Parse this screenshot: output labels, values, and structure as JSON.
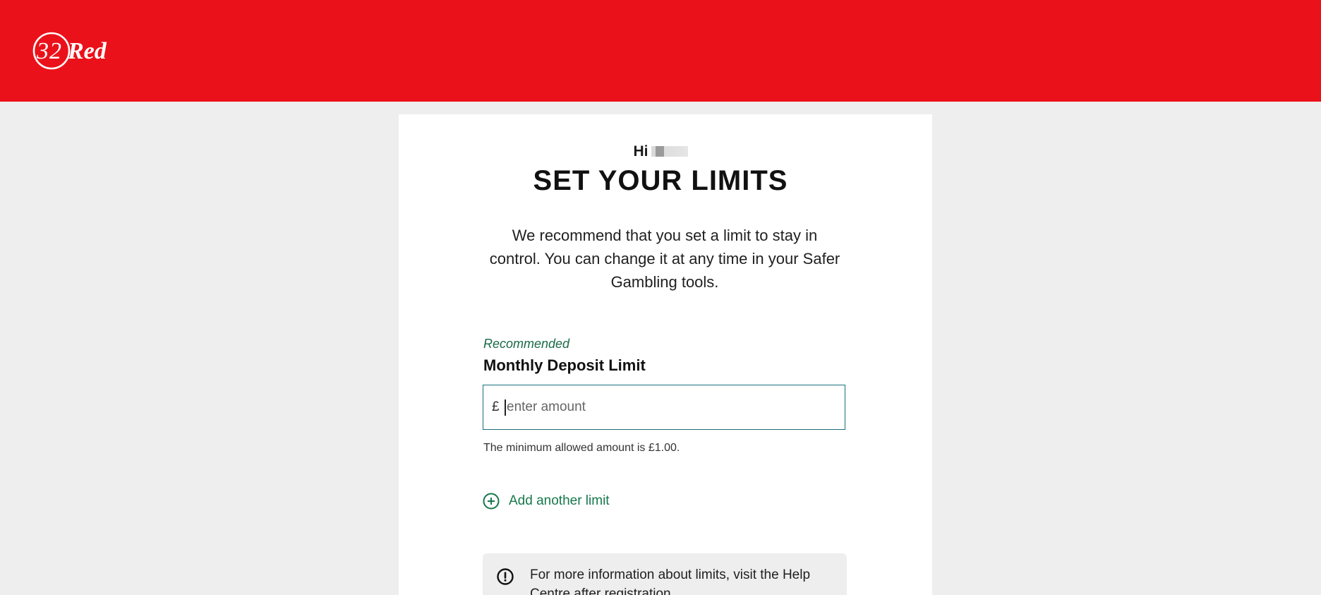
{
  "header": {
    "logo_text": "32Red",
    "brand_color": "#eb111a"
  },
  "greeting": {
    "prefix": "Hi"
  },
  "page": {
    "title": "SET YOUR LIMITS",
    "intro": "We recommend that you set a limit to stay in control. You can change it at any time in your Safer Gambling tools."
  },
  "limit": {
    "tag": "Recommended",
    "label": "Monthly Deposit Limit",
    "currency_symbol": "£",
    "placeholder": "enter amount",
    "hint": "The minimum allowed amount is £1.00."
  },
  "actions": {
    "add_limit_label": "Add another limit",
    "add_icon": "plus-circle-icon",
    "accent_color": "#17784b"
  },
  "info": {
    "icon": "exclamation-circle-icon",
    "text": "For more information about limits, visit the Help Centre after registration."
  }
}
